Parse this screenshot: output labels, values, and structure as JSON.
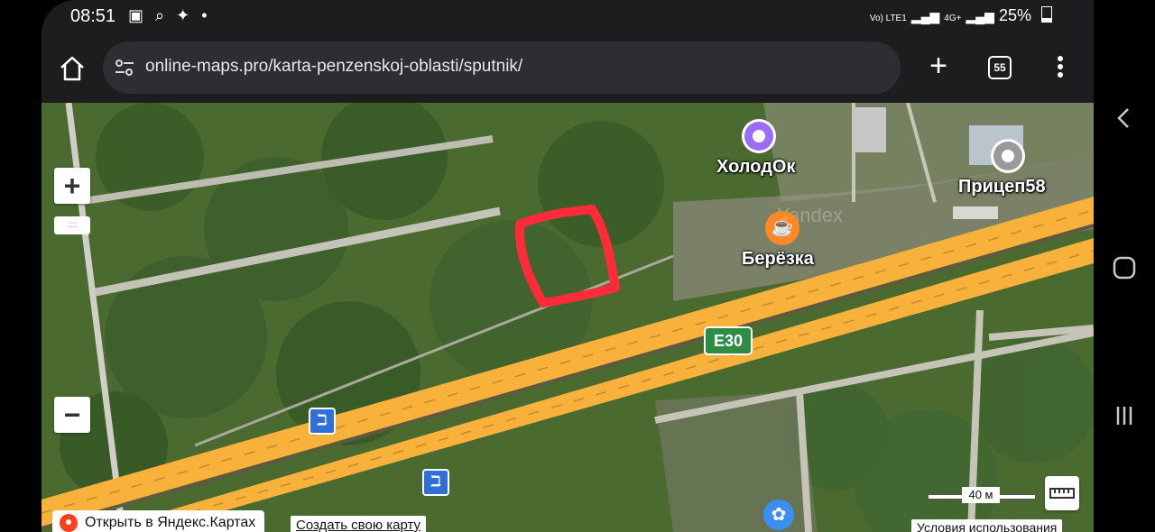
{
  "status_bar": {
    "time": "08:51",
    "left_icons": [
      "image-icon",
      "search-icon",
      "sparkle-icon",
      "dot-icon"
    ],
    "network": "Vo) LTE1",
    "signal": "4G+",
    "battery": "25%"
  },
  "browser": {
    "url": "online-maps.pro/karta-penzenskoj-oblasti/sputnik/",
    "tab_count": "55"
  },
  "map": {
    "pois": [
      {
        "label": "ХолодОк",
        "icon": "poi-dot-icon",
        "color": "#9b6cf6"
      },
      {
        "label": "Прицеп58",
        "icon": "poi-dot-icon",
        "color": "#9a9a9a"
      },
      {
        "label": "Берёзка",
        "icon": "cafe-icon",
        "color": "#ff8a25"
      }
    ],
    "road_label": "E30",
    "watermark": "Yandex",
    "scale_label": "40 м",
    "open_in_yandex": "Открыть в Яндекс.Картах",
    "create_map": "Создать свою карту",
    "terms": "Условия использования",
    "accent_color": "#f8b23c",
    "highlight_color": "#ff2a3a"
  }
}
